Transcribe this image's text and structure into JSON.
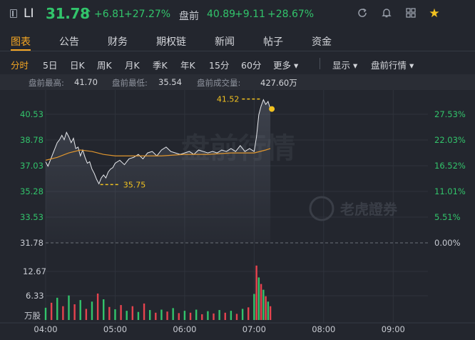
{
  "header": {
    "symbol": "LI",
    "price": "31.78",
    "arrow": "↑",
    "change": "+6.81",
    "change_pct": "+27.27%",
    "premarket_label": "盘前",
    "premarket_price": "40.89",
    "premarket_change": "+9.11",
    "premarket_change_pct": "+28.67%",
    "icons": [
      "refresh-icon",
      "bell-icon",
      "grid-icon",
      "star-icon"
    ]
  },
  "tabs": [
    "图表",
    "公告",
    "财务",
    "期权链",
    "新闻",
    "帖子",
    "资金"
  ],
  "active_tab": "图表",
  "periods": [
    "分时",
    "5日",
    "日K",
    "周K",
    "月K",
    "季K",
    "年K",
    "15分",
    "60分",
    "更多 ▾"
  ],
  "active_period": "分时",
  "display_menu": "显示 ▾",
  "premarket_menu": "盘前行情 ▾",
  "stats": {
    "high_label": "盘前最高:",
    "high_value": "41.70",
    "low_label": "盘前最低:",
    "low_value": "35.54",
    "volume_label": "盘前成交量:",
    "volume_value": "427.60万"
  },
  "watermark": {
    "text": "盘前行情",
    "logo_text": "老虎證券"
  },
  "colors": {
    "up": "#32c46b",
    "down": "#e6434e",
    "accent": "#f5a623",
    "avg_line": "#e0962e",
    "marker": "#f2c220"
  },
  "chart_data": {
    "type": "line",
    "title": "",
    "price_axis_left": [
      "40.53",
      "38.78",
      "37.03",
      "35.28",
      "33.53",
      "31.78"
    ],
    "pct_axis_right": [
      "27.53%",
      "22.03%",
      "16.52%",
      "11.01%",
      "5.51%",
      "0.00%"
    ],
    "volume_axis": [
      "12.67",
      "6.33",
      "万股"
    ],
    "x_ticks": [
      "04:00",
      "05:00",
      "06:00",
      "07:00",
      "08:00",
      "09:00"
    ],
    "x_range": [
      "04:00",
      "09:30"
    ],
    "y_range": [
      31.78,
      41.52
    ],
    "prev_close": 31.78,
    "max_annotation": {
      "value": "41.52",
      "time": "07:08"
    },
    "min_annotation": {
      "value": "35.75",
      "time": "04:46"
    },
    "last_price_marker": {
      "time": "07:14",
      "value": 40.89
    },
    "series": [
      {
        "name": "",
        "role": "price",
        "points": [
          [
            "04:00",
            37.3
          ],
          [
            "04:02",
            37.0
          ],
          [
            "04:04",
            37.4
          ],
          [
            "04:06",
            37.8
          ],
          [
            "04:08",
            38.2
          ],
          [
            "04:10",
            38.6
          ],
          [
            "04:12",
            38.8
          ],
          [
            "04:14",
            39.1
          ],
          [
            "04:16",
            38.8
          ],
          [
            "04:18",
            39.3
          ],
          [
            "04:20",
            39.0
          ],
          [
            "04:22",
            38.6
          ],
          [
            "04:24",
            38.9
          ],
          [
            "04:26",
            38.2
          ],
          [
            "04:28",
            38.3
          ],
          [
            "04:30",
            37.7
          ],
          [
            "04:32",
            38.1
          ],
          [
            "04:34",
            37.6
          ],
          [
            "04:36",
            37.2
          ],
          [
            "04:38",
            37.3
          ],
          [
            "04:40",
            36.8
          ],
          [
            "04:42",
            36.5
          ],
          [
            "04:44",
            36.1
          ],
          [
            "04:46",
            35.8
          ],
          [
            "04:48",
            36.2
          ],
          [
            "04:50",
            36.4
          ],
          [
            "04:52",
            36.2
          ],
          [
            "04:54",
            36.6
          ],
          [
            "04:56",
            36.8
          ],
          [
            "04:58",
            36.9
          ],
          [
            "05:00",
            37.2
          ],
          [
            "05:04",
            37.4
          ],
          [
            "05:08",
            37.1
          ],
          [
            "05:12",
            37.5
          ],
          [
            "05:16",
            37.6
          ],
          [
            "05:20",
            37.8
          ],
          [
            "05:24",
            37.5
          ],
          [
            "05:28",
            37.9
          ],
          [
            "05:32",
            38.0
          ],
          [
            "05:36",
            37.7
          ],
          [
            "05:40",
            38.1
          ],
          [
            "05:44",
            38.3
          ],
          [
            "05:48",
            38.0
          ],
          [
            "05:52",
            37.9
          ],
          [
            "05:56",
            37.8
          ],
          [
            "06:00",
            37.9
          ],
          [
            "06:04",
            38.0
          ],
          [
            "06:08",
            37.8
          ],
          [
            "06:12",
            38.1
          ],
          [
            "06:16",
            38.0
          ],
          [
            "06:20",
            37.9
          ],
          [
            "06:24",
            38.0
          ],
          [
            "06:28",
            37.9
          ],
          [
            "06:32",
            38.1
          ],
          [
            "06:36",
            38.0
          ],
          [
            "06:40",
            38.2
          ],
          [
            "06:44",
            38.0
          ],
          [
            "06:48",
            38.4
          ],
          [
            "06:52",
            38.0
          ],
          [
            "06:56",
            38.2
          ],
          [
            "07:00",
            38.0
          ],
          [
            "07:02",
            39.0
          ],
          [
            "07:04",
            40.5
          ],
          [
            "07:06",
            41.1
          ],
          [
            "07:08",
            41.52
          ],
          [
            "07:10",
            41.2
          ],
          [
            "07:12",
            41.4
          ],
          [
            "07:14",
            40.89
          ]
        ]
      },
      {
        "name": "",
        "role": "average",
        "points": [
          [
            "04:00",
            37.4
          ],
          [
            "04:10",
            37.6
          ],
          [
            "04:20",
            37.9
          ],
          [
            "04:30",
            38.1
          ],
          [
            "04:40",
            38.0
          ],
          [
            "04:50",
            37.8
          ],
          [
            "05:00",
            37.7
          ],
          [
            "05:20",
            37.7
          ],
          [
            "05:40",
            37.7
          ],
          [
            "06:00",
            37.8
          ],
          [
            "06:20",
            37.8
          ],
          [
            "06:40",
            37.9
          ],
          [
            "07:00",
            37.9
          ],
          [
            "07:10",
            38.1
          ],
          [
            "07:14",
            38.2
          ]
        ]
      }
    ],
    "volume": [
      [
        "04:00",
        3.2,
        "up"
      ],
      [
        "04:05",
        4.5,
        "down"
      ],
      [
        "04:10",
        5.8,
        "up"
      ],
      [
        "04:15",
        3.6,
        "down"
      ],
      [
        "04:20",
        6.4,
        "up"
      ],
      [
        "04:25",
        4.1,
        "down"
      ],
      [
        "04:30",
        5.2,
        "up"
      ],
      [
        "04:35",
        2.9,
        "down"
      ],
      [
        "04:40",
        4.8,
        "up"
      ],
      [
        "04:45",
        6.9,
        "down"
      ],
      [
        "04:50",
        5.4,
        "up"
      ],
      [
        "04:55",
        3.4,
        "down"
      ],
      [
        "05:00",
        2.8,
        "up"
      ],
      [
        "05:05",
        3.9,
        "down"
      ],
      [
        "05:10",
        2.4,
        "up"
      ],
      [
        "05:15",
        3.6,
        "down"
      ],
      [
        "05:20",
        2.1,
        "up"
      ],
      [
        "05:25",
        4.3,
        "down"
      ],
      [
        "05:30",
        2.6,
        "up"
      ],
      [
        "05:35",
        1.9,
        "down"
      ],
      [
        "05:40",
        2.7,
        "up"
      ],
      [
        "05:45",
        2.2,
        "down"
      ],
      [
        "05:50",
        3.1,
        "up"
      ],
      [
        "05:55",
        1.8,
        "down"
      ],
      [
        "06:00",
        2.4,
        "up"
      ],
      [
        "06:05",
        1.9,
        "down"
      ],
      [
        "06:10",
        2.7,
        "up"
      ],
      [
        "06:15",
        1.5,
        "down"
      ],
      [
        "06:20",
        2.3,
        "up"
      ],
      [
        "06:25",
        1.7,
        "down"
      ],
      [
        "06:30",
        2.6,
        "up"
      ],
      [
        "06:35",
        1.9,
        "down"
      ],
      [
        "06:40",
        2.4,
        "up"
      ],
      [
        "06:45",
        1.6,
        "down"
      ],
      [
        "06:50",
        2.9,
        "up"
      ],
      [
        "06:55",
        3.3,
        "down"
      ],
      [
        "07:00",
        6.8,
        "up"
      ],
      [
        "07:02",
        14.2,
        "down"
      ],
      [
        "07:04",
        11.1,
        "up"
      ],
      [
        "07:06",
        9.4,
        "down"
      ],
      [
        "07:08",
        7.9,
        "up"
      ],
      [
        "07:10",
        6.2,
        "down"
      ],
      [
        "07:12",
        4.8,
        "up"
      ],
      [
        "07:14",
        3.6,
        "down"
      ]
    ]
  }
}
